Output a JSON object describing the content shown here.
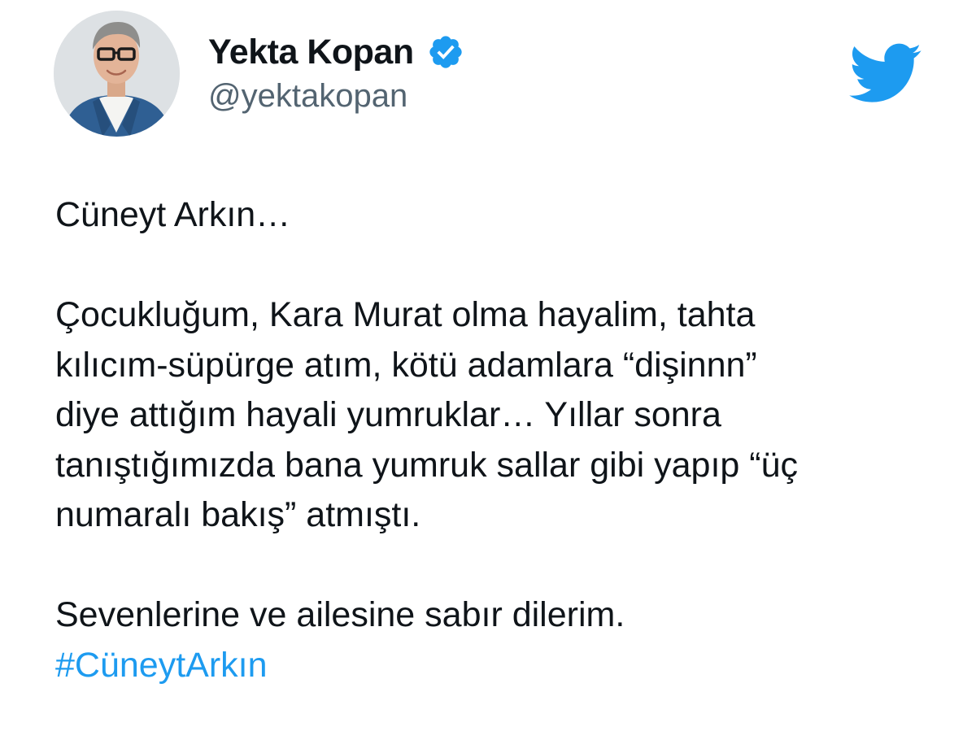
{
  "author": {
    "name": "Yekta Kopan",
    "handle": "@yektakopan",
    "verified": true
  },
  "tweet": {
    "intro": "Cüneyt Arkın…",
    "memory_lines": [
      "Çocukluğum, Kara Murat olma hayalim, tahta",
      "kılıcım-süpürge atım, kötü adamlara “dişinnn”",
      "diye attığım hayali yumruklar… Yıllar sonra",
      "tanıştığımızda bana yumruk sallar gibi yapıp “üç",
      "numaralı bakış” atmıştı."
    ],
    "condolence": "Sevenlerine ve ailesine sabır dilerim.",
    "hashtag": "#CüneytArkın"
  },
  "icons": {
    "verified": "verified-badge-icon",
    "brand": "twitter-bird-icon"
  },
  "colors": {
    "brand": "#1d9bf0",
    "text": "#0f1419",
    "secondary_text": "#536471"
  }
}
